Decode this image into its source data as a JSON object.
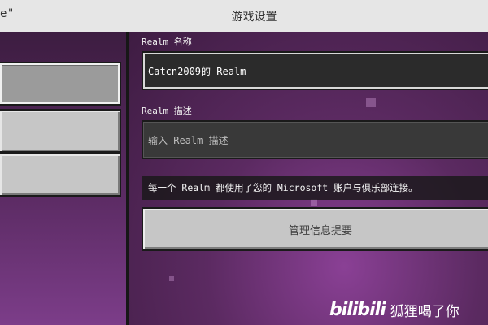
{
  "topbar": {
    "left_fragment": "e\"",
    "title": "游戏设置"
  },
  "sidebar": {
    "items": [
      {
        "label": "",
        "selected": true
      },
      {
        "label": "",
        "selected": false
      },
      {
        "label": "",
        "selected": false
      }
    ]
  },
  "form": {
    "name_label": "Realm 名称",
    "name_value": "Catcn2009的 Realm",
    "description_label": "Realm 描述",
    "description_placeholder": "输入 Realm 描述",
    "info_text": "每一个 Realm 都使用了您的 Microsoft 账户与俱乐部连接。",
    "manage_button": "管理信息提要"
  },
  "watermark": {
    "logo": "bilibili",
    "text": "狐狸喝了你"
  },
  "colors": {
    "background_purple": "#5a2a5e",
    "button_gray": "#c6c6c6",
    "field_dark": "#2b2b2b"
  }
}
